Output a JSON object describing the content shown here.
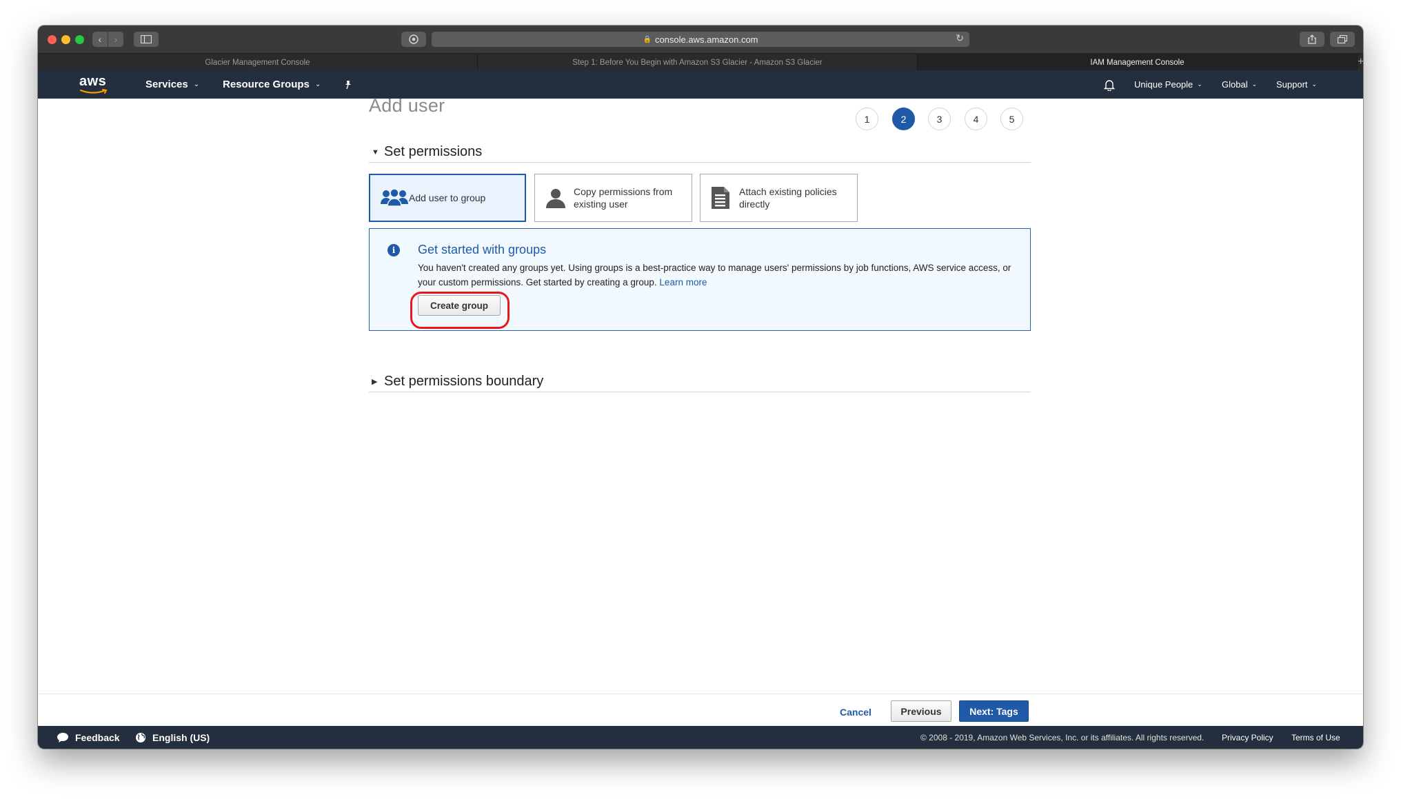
{
  "browser": {
    "url": "console.aws.amazon.com",
    "tabs": [
      {
        "label": "Glacier Management Console",
        "active": false
      },
      {
        "label": "Step 1: Before You Begin with Amazon S3 Glacier - Amazon S3 Glacier",
        "active": false
      },
      {
        "label": "IAM Management Console",
        "active": true
      }
    ],
    "new_tab": "+"
  },
  "aws_nav": {
    "logo": "aws",
    "services": "Services",
    "resource_groups": "Resource Groups",
    "account": "Unique People",
    "region": "Global",
    "support": "Support"
  },
  "page": {
    "title": "Add user",
    "steps": [
      "1",
      "2",
      "3",
      "4",
      "5"
    ],
    "active_step": "2"
  },
  "permissions": {
    "section_title": "Set permissions",
    "options": [
      {
        "label": "Add user to group",
        "selected": true,
        "icon": "users-group-icon"
      },
      {
        "label": "Copy permissions from existing user",
        "selected": false,
        "icon": "user-icon"
      },
      {
        "label": "Attach existing policies directly",
        "selected": false,
        "icon": "document-icon"
      }
    ],
    "info": {
      "icon": "info-icon",
      "title": "Get started with groups",
      "body": "You haven't created any groups yet. Using groups is a best-practice way to manage users' permissions by job functions, AWS service access, or your custom permissions. Get started by creating a group.",
      "link": "Learn more",
      "button": "Create group"
    },
    "boundary_title": "Set permissions boundary"
  },
  "actions": {
    "cancel": "Cancel",
    "previous": "Previous",
    "next": "Next: Tags"
  },
  "footer": {
    "feedback": "Feedback",
    "language": "English (US)",
    "copyright": "© 2008 - 2019, Amazon Web Services, Inc. or its affiliates. All rights reserved.",
    "privacy": "Privacy Policy",
    "terms": "Terms of Use"
  },
  "colors": {
    "aws_nav_bg": "#232f3e",
    "primary_blue": "#1e5aa8",
    "highlight_red": "#e8171a"
  }
}
